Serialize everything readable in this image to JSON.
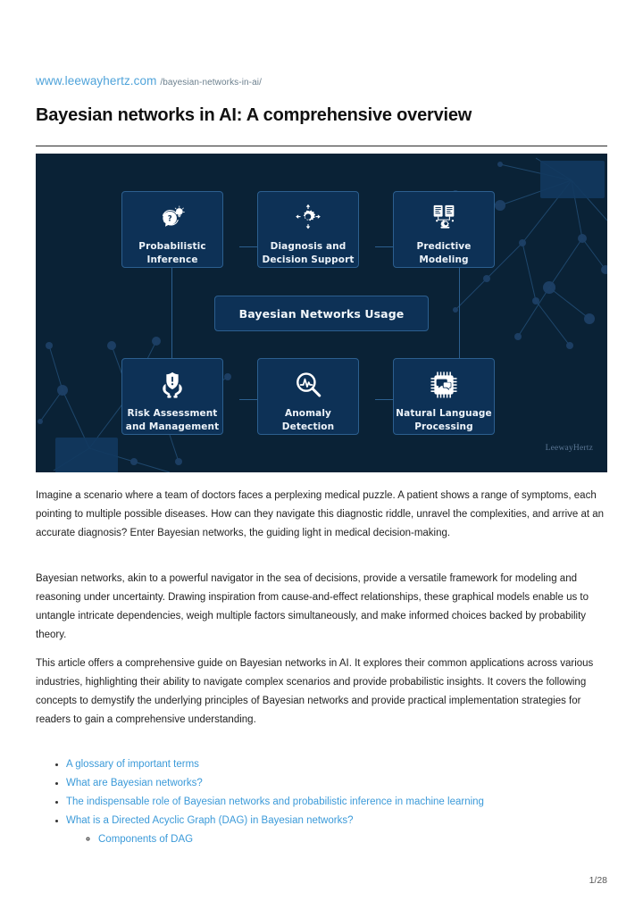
{
  "header": {
    "url_domain": "www.leewayhertz.com",
    "url_path": "/bayesian-networks-in-ai/",
    "title": "Bayesian networks in AI: A comprehensive overview"
  },
  "infographic": {
    "center_label": "Bayesian Networks Usage",
    "watermark": "LeewayHertz",
    "background_color": "#0a2236",
    "card_color": "#0d3156",
    "border_color": "#2c5f8f",
    "cards": [
      {
        "label": "Probabilistic\nInference",
        "icon": "brain-question-lightbulb-icon"
      },
      {
        "label": "Diagnosis and\nDecision Support",
        "icon": "gear-arrows-icon"
      },
      {
        "label": "Predictive\nModeling",
        "icon": "documents-gear-icon"
      },
      {
        "label": "Risk Assessment\nand Management",
        "icon": "shield-hands-icon"
      },
      {
        "label": "Anomaly\nDetection",
        "icon": "magnifier-waveform-icon"
      },
      {
        "label": "Natural Language\nProcessing",
        "icon": "chip-chat-icon"
      }
    ]
  },
  "body": {
    "paragraphs": [
      "Imagine a scenario where a team of doctors faces a perplexing medical puzzle. A patient shows a range of symptoms, each pointing to multiple possible diseases. How can they navigate this diagnostic riddle, unravel the complexities, and arrive at an accurate diagnosis? Enter Bayesian networks, the guiding light in medical decision-making.",
      "Bayesian networks, akin to a powerful navigator in the sea of decisions, provide a versatile framework for modeling and reasoning under uncertainty. Drawing inspiration from cause-and-effect relationships, these graphical models enable us to untangle intricate dependencies, weigh multiple factors simultaneously, and make informed choices backed by probability theory.",
      "This article offers a comprehensive guide on Bayesian networks in AI. It explores their common applications across various industries, highlighting their ability to navigate complex scenarios and provide probabilistic insights. It covers the following concepts to demystify the underlying principles of Bayesian networks and provide practical implementation strategies for readers to gain a comprehensive understanding."
    ],
    "toc_links": [
      "A glossary of important terms",
      "What are Bayesian networks?",
      "The indispensable role of Bayesian networks and probabilistic inference in machine learning",
      "What is a Directed Acyclic Graph (DAG) in Bayesian networks?"
    ],
    "toc_sublinks": [
      "Components of DAG"
    ],
    "link_color": "#3b9ad9"
  },
  "footer": {
    "page_number": "1/28"
  }
}
